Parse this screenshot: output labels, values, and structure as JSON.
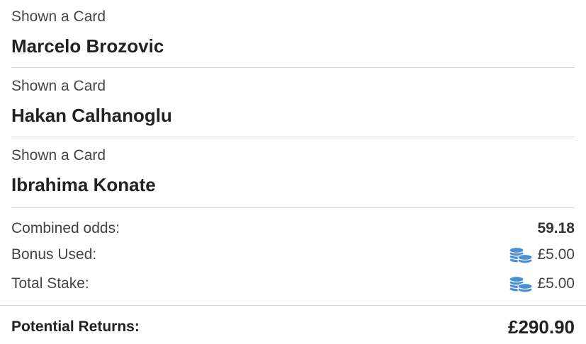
{
  "selections": [
    {
      "market": "Shown a Card",
      "player": "Marcelo Brozovic"
    },
    {
      "market": "Shown a Card",
      "player": "Hakan Calhanoglu"
    },
    {
      "market": "Shown a Card",
      "player": "Ibrahima Konate"
    }
  ],
  "summary": {
    "combined_odds_label": "Combined odds:",
    "combined_odds_value": "59.18",
    "bonus_used_label": "Bonus Used:",
    "bonus_used_value": "£5.00",
    "total_stake_label": "Total Stake:",
    "total_stake_value": "£5.00",
    "bonus_icon": "coins-icon"
  },
  "returns": {
    "label": "Potential Returns:",
    "value": "£290.90"
  },
  "colors": {
    "coin": "#4a8fd6",
    "divider": "#d6d6d6"
  }
}
